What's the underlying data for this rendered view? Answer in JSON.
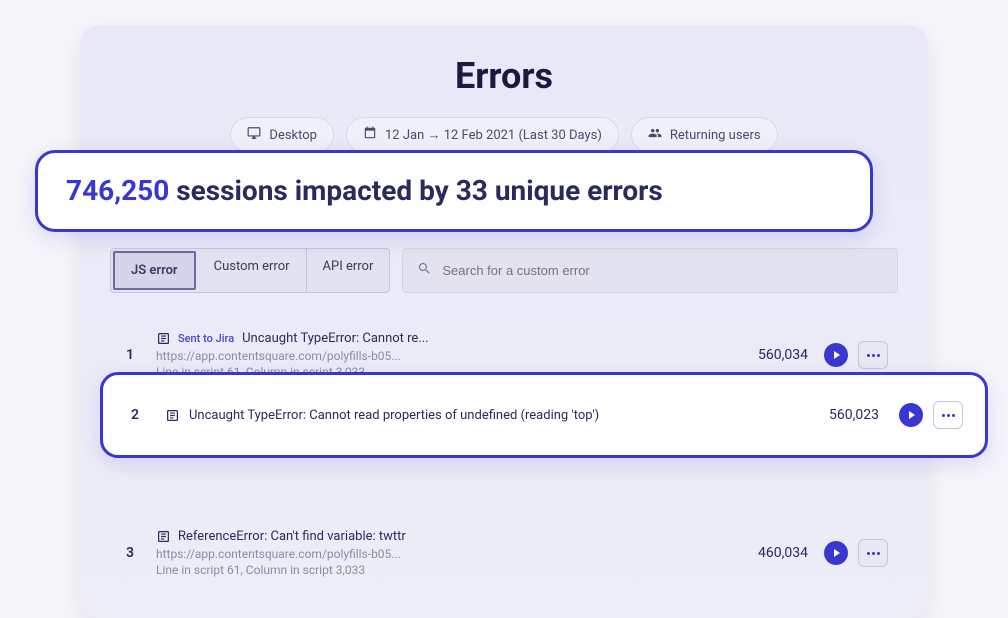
{
  "header": {
    "title": "Errors"
  },
  "filters": {
    "device": "Desktop",
    "dateRange": "12 Jan → 12 Feb 2021 (Last 30 Days)",
    "userType": "Returning users"
  },
  "stat": {
    "count": "746,250",
    "text_after": "sessions impacted by 33 unique errors"
  },
  "tabs": {
    "js": "JS error",
    "custom": "Custom error",
    "api": "API error"
  },
  "search": {
    "placeholder": "Search for a custom error"
  },
  "errors": [
    {
      "index": "1",
      "sent_to_jira": "Sent to Jira",
      "title": "Uncaught TypeError: Cannot re...",
      "url": "https://app.contentsquare.com/polyfills-b05...",
      "meta": "Line in script 61, Column in script 3,033",
      "count": "560,034"
    },
    {
      "index": "2",
      "title": "Uncaught TypeError: Cannot read properties of undefined (reading 'top')",
      "count": "560,023"
    },
    {
      "index": "3",
      "title": "ReferenceError: Can't find variable: twttr",
      "url": "https://app.contentsquare.com/polyfills-b05...",
      "meta": "Line in script 61, Column in script 3,033",
      "count": "460,034"
    }
  ]
}
